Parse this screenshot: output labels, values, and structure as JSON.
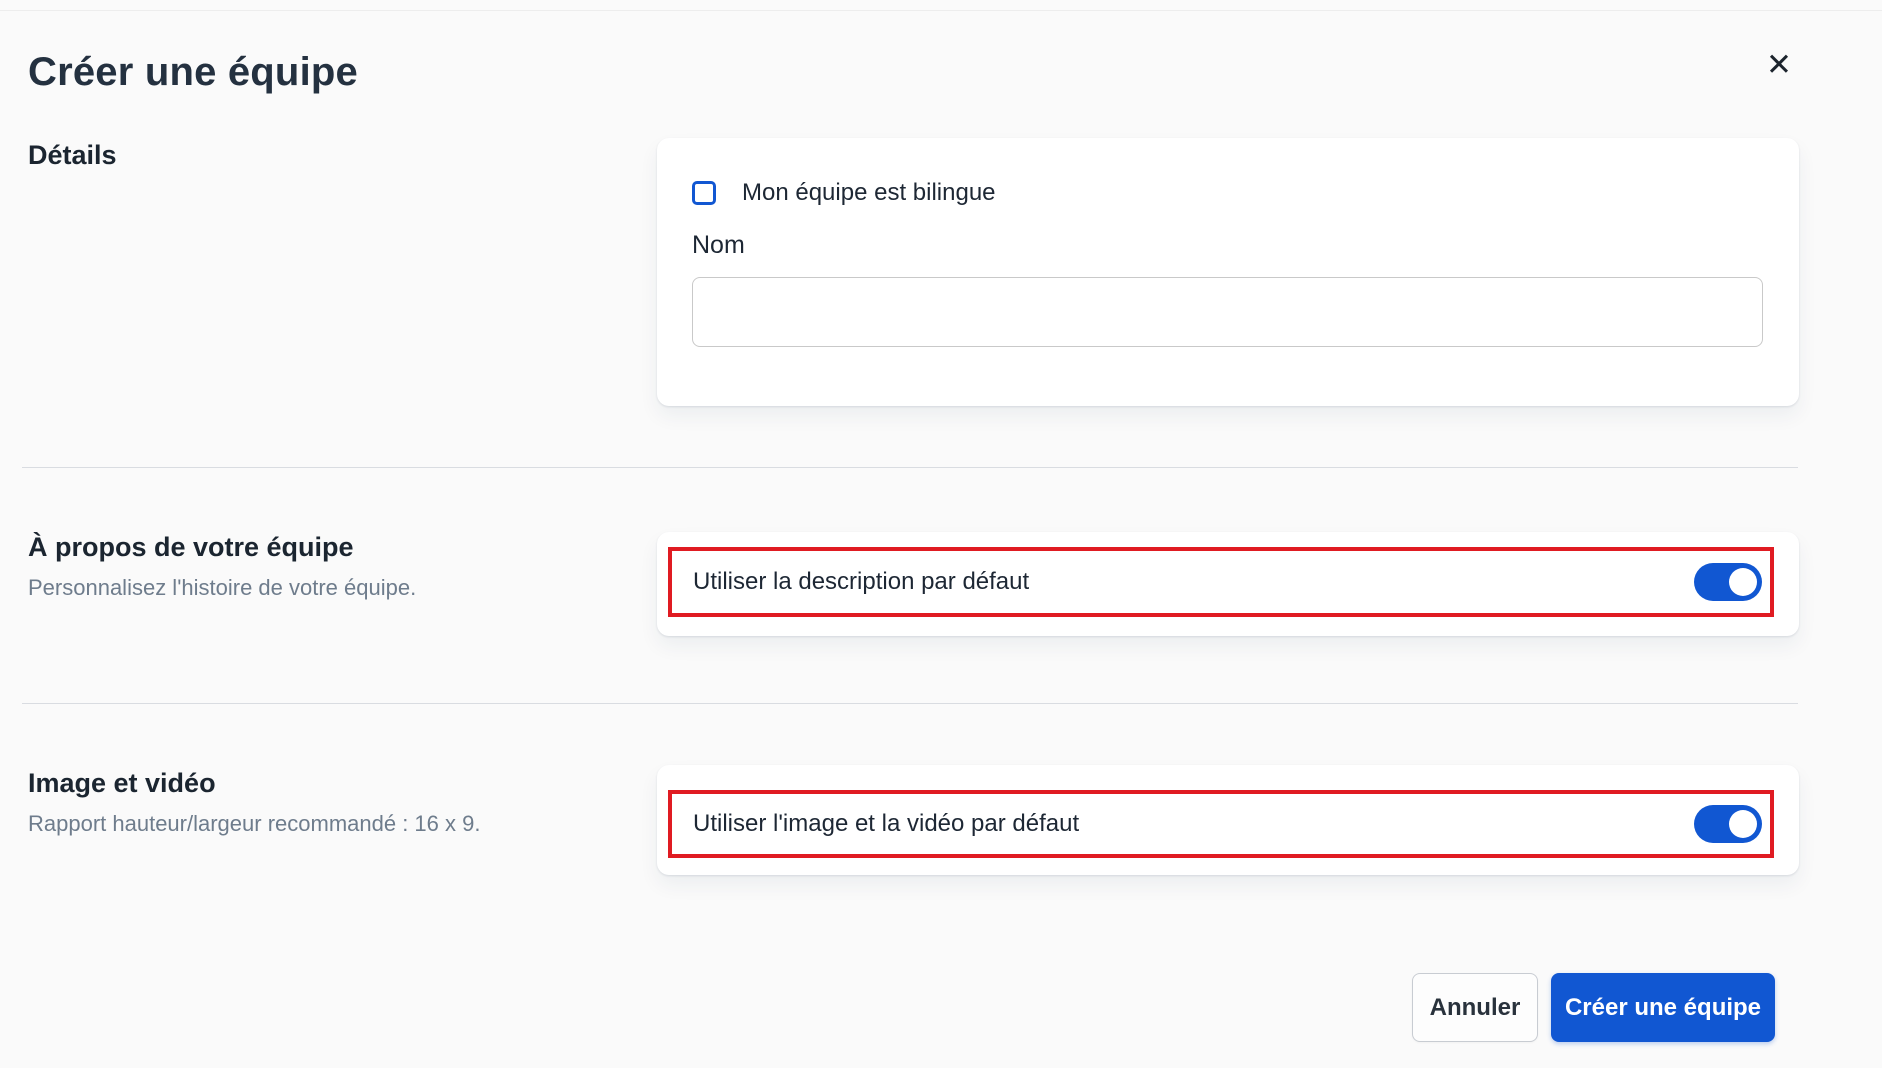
{
  "header": {
    "title": "Créer une équipe",
    "close_icon": "✕"
  },
  "details": {
    "heading": "Détails",
    "checkbox_label": "Mon équipe est bilingue",
    "checkbox_checked": false,
    "name_label": "Nom",
    "name_value": "",
    "name_placeholder": ""
  },
  "about": {
    "heading": "À propos de votre équipe",
    "subtitle": "Personnalisez l'histoire de votre équipe.",
    "toggle_label": "Utiliser la description par défaut",
    "toggle_on": true
  },
  "media": {
    "heading": "Image et vidéo",
    "subtitle": "Rapport hauteur/largeur recommandé : 16 x 9.",
    "toggle_label": "Utiliser l'image et la vidéo par défaut",
    "toggle_on": true
  },
  "footer": {
    "cancel_label": "Annuler",
    "submit_label": "Créer une équipe"
  },
  "colors": {
    "brand_blue": "#1157d2",
    "annotation_red": "#e01b22",
    "text_dark": "#222c38",
    "text_gray": "#6e7c8c",
    "page_bg": "#fafafa",
    "card_bg": "#ffffff",
    "divider": "#d9dce1"
  }
}
